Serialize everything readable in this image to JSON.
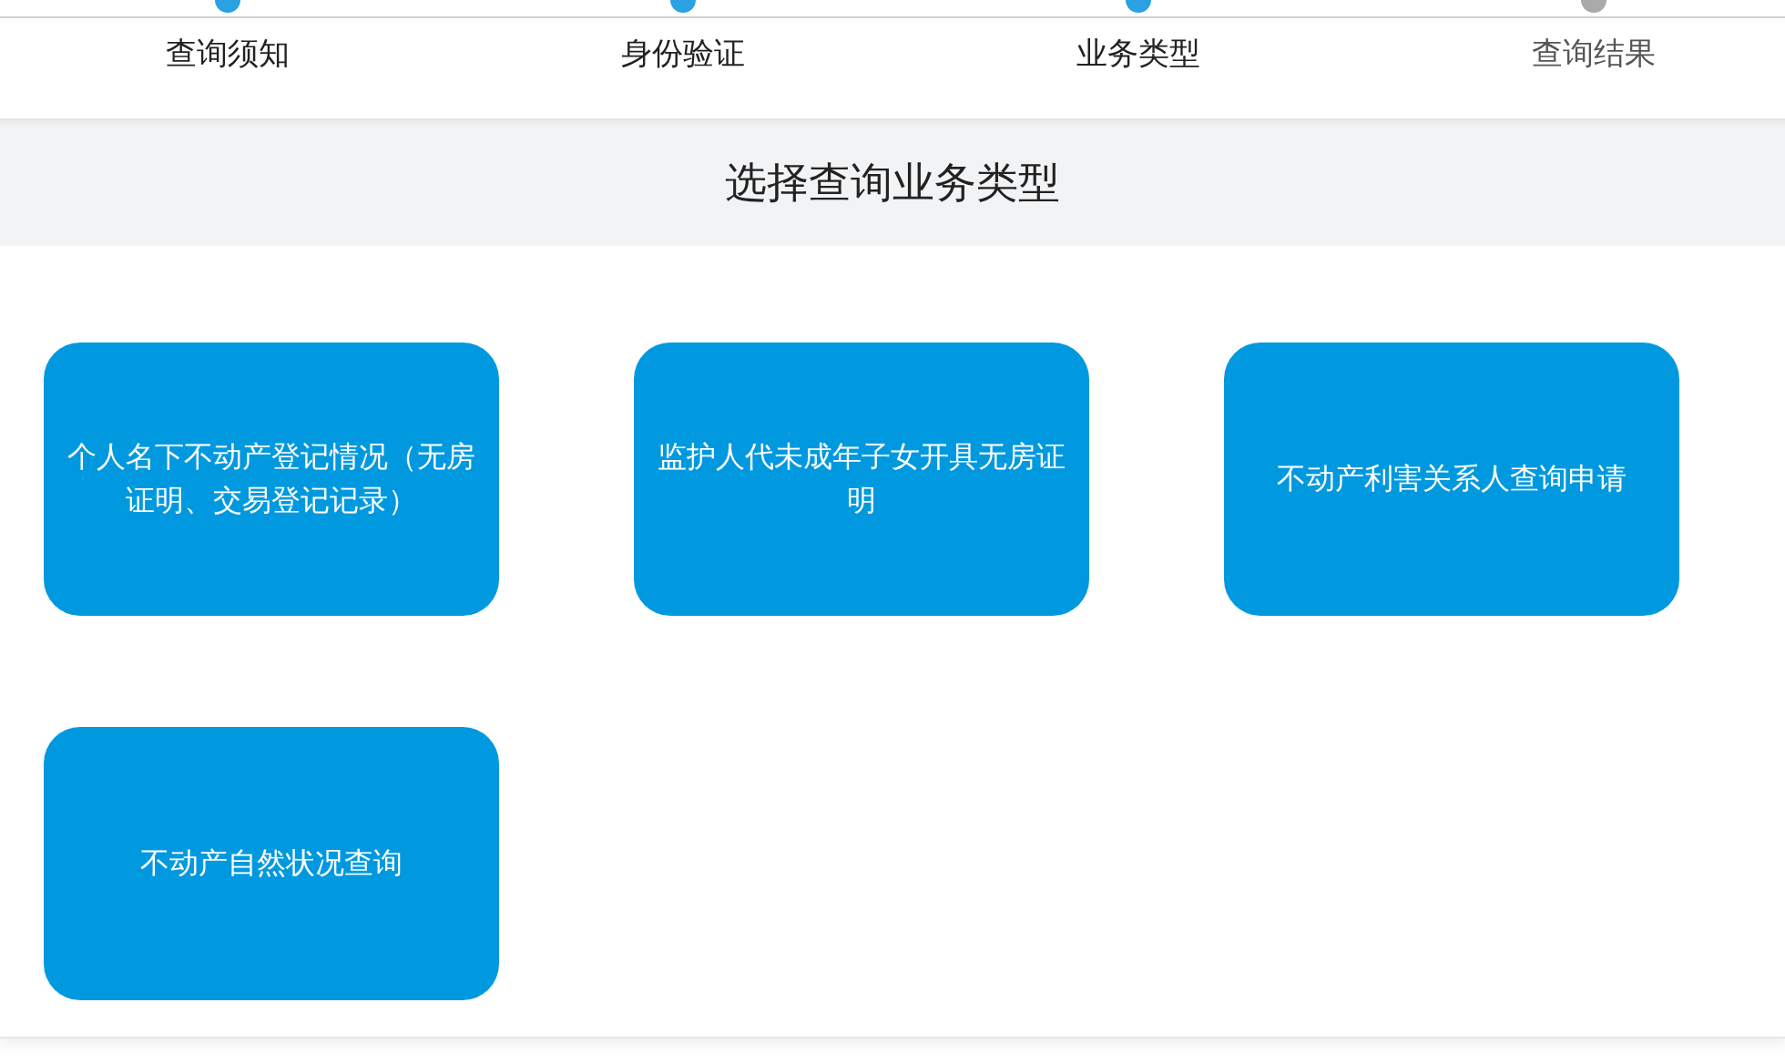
{
  "steps": [
    {
      "label": "查询须知",
      "active": true
    },
    {
      "label": "身份验证",
      "active": true
    },
    {
      "label": "业务类型",
      "active": true
    },
    {
      "label": "查询结果",
      "active": false
    }
  ],
  "section": {
    "title": "选择查询业务类型"
  },
  "business_types": [
    {
      "label": "个人名下不动产登记情况（无房证明、交易登记记录）"
    },
    {
      "label": "监护人代未成年子女开具无房证明"
    },
    {
      "label": "不动产利害关系人查询申请"
    },
    {
      "label": "不动产自然状况查询"
    }
  ]
}
